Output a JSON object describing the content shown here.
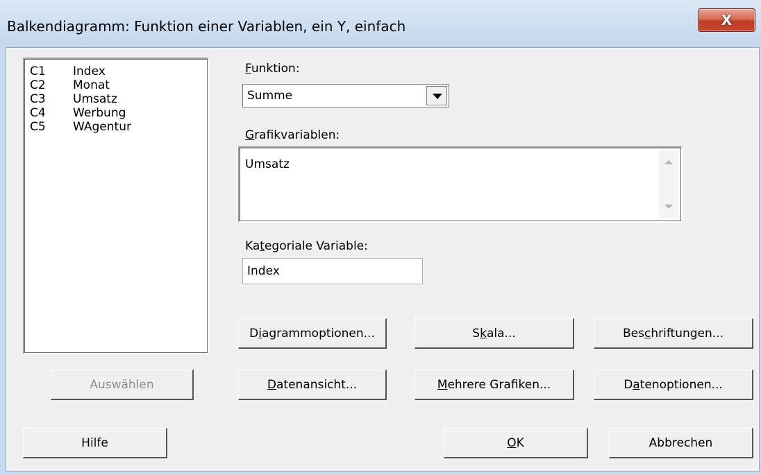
{
  "window": {
    "title": "Balkendiagramm: Funktion einer Variablen, ein Y, einfach",
    "close_label": "X"
  },
  "variables": [
    {
      "col": "C1",
      "name": "Index"
    },
    {
      "col": "C2",
      "name": "Monat"
    },
    {
      "col": "C3",
      "name": "Umsatz"
    },
    {
      "col": "C4",
      "name": "Werbung"
    },
    {
      "col": "C5",
      "name": "WAgentur"
    }
  ],
  "funktion": {
    "label_hot": "F",
    "label_rest": "unktion:",
    "value": "Summe"
  },
  "grafikvariablen": {
    "label_hot": "G",
    "label_rest": "rafikvariablen:",
    "value": "Umsatz"
  },
  "kategoriale": {
    "label_pre": "Ka",
    "label_hot": "t",
    "label_rest": "egoriale Variable:",
    "value": "Index"
  },
  "buttons": {
    "diagrammoptionen": {
      "pre": "D",
      "hot": "i",
      "post": "agrammoptionen..."
    },
    "skala": {
      "pre": "S",
      "hot": "k",
      "post": "ala..."
    },
    "beschriftungen": {
      "pre": "Bes",
      "hot": "c",
      "post": "hriftungen..."
    },
    "auswaehlen": {
      "pre": "",
      "hot": "",
      "post": "Auswählen"
    },
    "datenansicht": {
      "pre": "",
      "hot": "D",
      "post": "atenansicht..."
    },
    "mehrere_grafiken": {
      "pre": "",
      "hot": "M",
      "post": "ehrere Grafiken..."
    },
    "datenoptionen": {
      "pre": "D",
      "hot": "a",
      "post": "tenoptionen..."
    },
    "hilfe": {
      "pre": "",
      "hot": "",
      "post": "Hilfe"
    },
    "ok": {
      "pre": "",
      "hot": "O",
      "post": "K"
    },
    "abbrechen": {
      "pre": "",
      "hot": "",
      "post": "Abbrechen"
    }
  }
}
